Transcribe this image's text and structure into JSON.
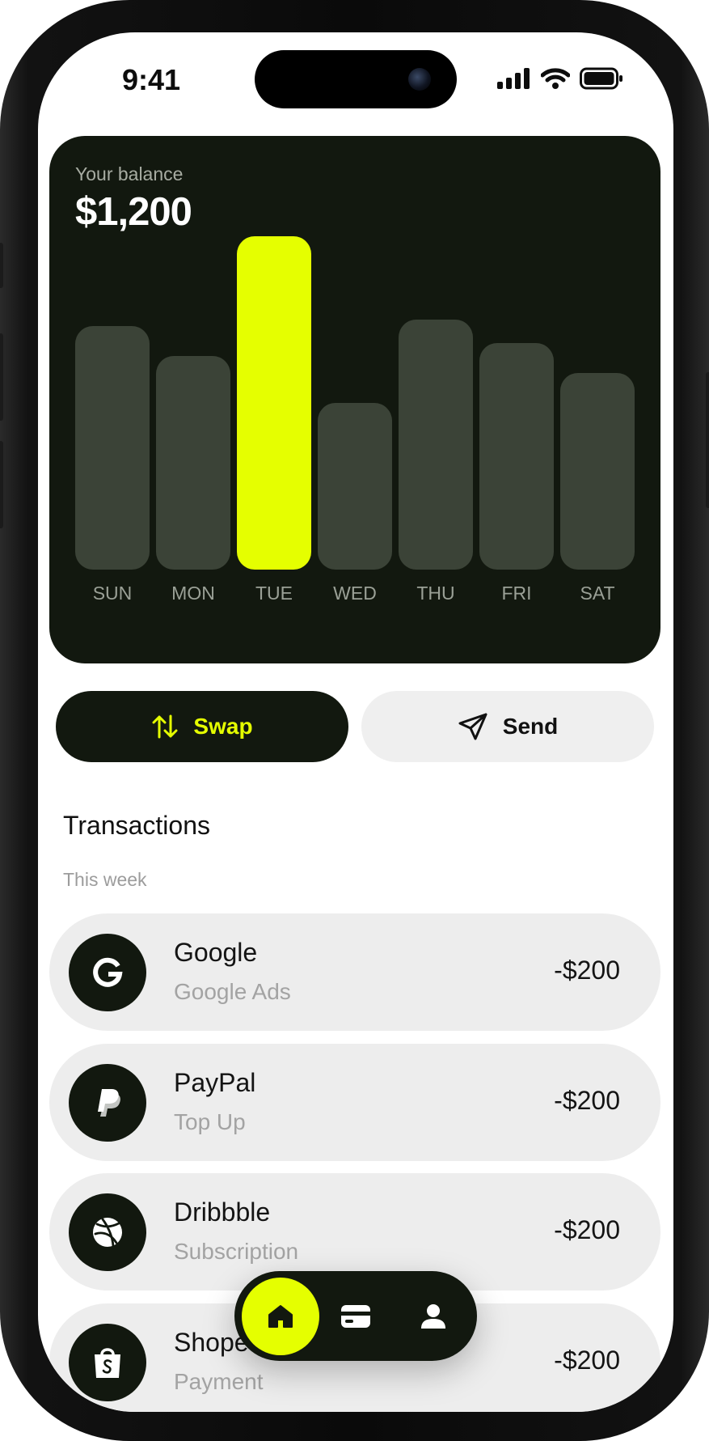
{
  "status_bar": {
    "time": "9:41"
  },
  "balance_card": {
    "label": "Your balance",
    "value": "$1,200"
  },
  "chart_data": {
    "type": "bar",
    "categories": [
      "SUN",
      "MON",
      "TUE",
      "WED",
      "THU",
      "FRI",
      "SAT"
    ],
    "values": [
      73,
      64,
      100,
      50,
      75,
      68,
      59
    ],
    "highlighted": "TUE",
    "highlight_color": "#e5ff00",
    "bar_color": "#3b4337",
    "title": "",
    "xlabel": "",
    "ylabel": ""
  },
  "actions": {
    "swap_label": "Swap",
    "send_label": "Send"
  },
  "transactions": {
    "title": "Transactions",
    "period": "This week",
    "items": [
      {
        "name": "Google",
        "desc": "Google Ads",
        "amount": "-$200",
        "icon": "google-icon"
      },
      {
        "name": "PayPal",
        "desc": "Top Up",
        "amount": "-$200",
        "icon": "paypal-icon"
      },
      {
        "name": "Dribbble",
        "desc": "Subscription",
        "amount": "-$200",
        "icon": "dribbble-icon"
      },
      {
        "name": "Shopee",
        "desc": "Payment",
        "amount": "-$200",
        "icon": "shopee-icon"
      }
    ]
  },
  "nav": {
    "items": [
      {
        "icon": "home-icon",
        "active": true
      },
      {
        "icon": "card-icon",
        "active": false
      },
      {
        "icon": "user-icon",
        "active": false
      }
    ]
  },
  "colors": {
    "accent": "#e5ff00",
    "dark": "#12180f",
    "surface": "#ededed"
  }
}
